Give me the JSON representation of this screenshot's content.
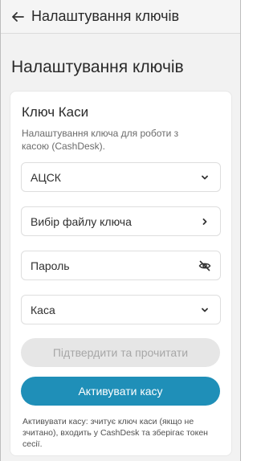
{
  "appbar": {
    "title": "Налаштування ключів",
    "back_icon": "arrow-left-icon"
  },
  "page": {
    "title": "Налаштування ключів"
  },
  "card": {
    "title": "Ключ Каси",
    "description": "Налаштування ключа для роботи з касою (CashDesk).",
    "fields": {
      "acsk": {
        "label": "АЦСК",
        "icon": "chevron-down-icon"
      },
      "key_file": {
        "label": "Вибір файлу ключа",
        "icon": "chevron-right-icon"
      },
      "password": {
        "label": "Пароль",
        "icon": "eye-off-icon"
      },
      "cashbox": {
        "label": "Каса",
        "icon": "chevron-down-icon"
      }
    },
    "confirm_button": "Підтвердити та прочитати",
    "activate_button": "Активувати касу",
    "footnote": "Активувати касу: зчитує ключ каси (якщо не зчитано), входить у CashDesk та зберігає токен сесії."
  },
  "colors": {
    "primary": "#1f8fb8",
    "disabled_bg": "#e6e6e6",
    "disabled_text": "#a7a7a7",
    "background": "#f2f2f2"
  }
}
